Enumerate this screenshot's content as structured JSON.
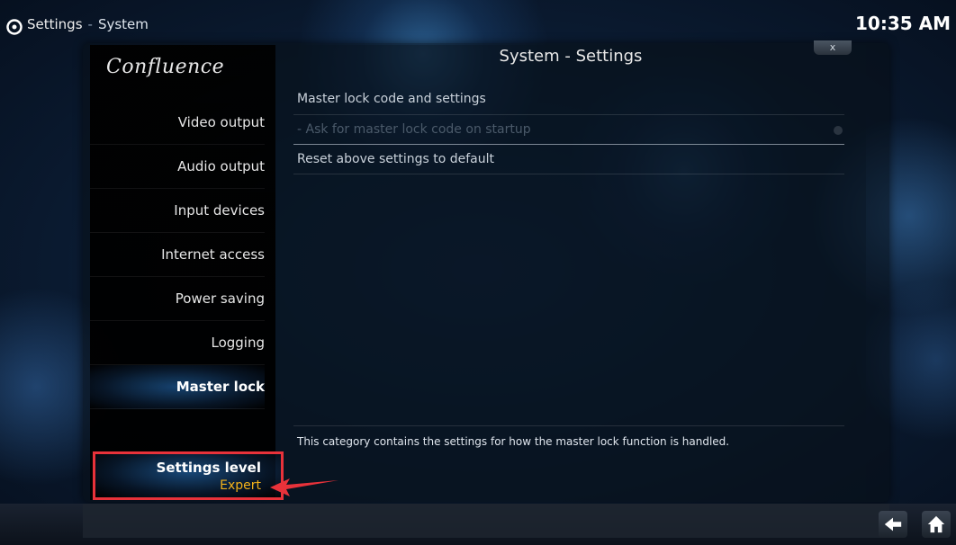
{
  "topbar": {
    "section": "Settings",
    "separator": "-",
    "page": "System",
    "clock": "10:35 AM"
  },
  "logo": "Confluence",
  "header": {
    "title": "System - Settings",
    "close_label": "x"
  },
  "sidebar": {
    "items": [
      {
        "label": "Video output"
      },
      {
        "label": "Audio output"
      },
      {
        "label": "Input devices"
      },
      {
        "label": "Internet access"
      },
      {
        "label": "Power saving"
      },
      {
        "label": "Logging"
      },
      {
        "label": "Master lock"
      }
    ],
    "selected_index": 6
  },
  "settings": {
    "items": [
      {
        "label": "Master lock code and settings",
        "enabled": true
      },
      {
        "label": "- Ask for master lock code on startup",
        "enabled": false
      },
      {
        "label": "Reset above settings to default",
        "enabled": true
      }
    ]
  },
  "description": "This category contains the settings for how the master lock function is handled.",
  "settings_level": {
    "label": "Settings level",
    "value": "Expert"
  },
  "colors": {
    "highlight_border": "#e8323a",
    "level_value": "#f2b11a"
  },
  "icons": {
    "top_left": "gear-icon",
    "back": "back-arrow-icon",
    "home": "home-icon"
  }
}
